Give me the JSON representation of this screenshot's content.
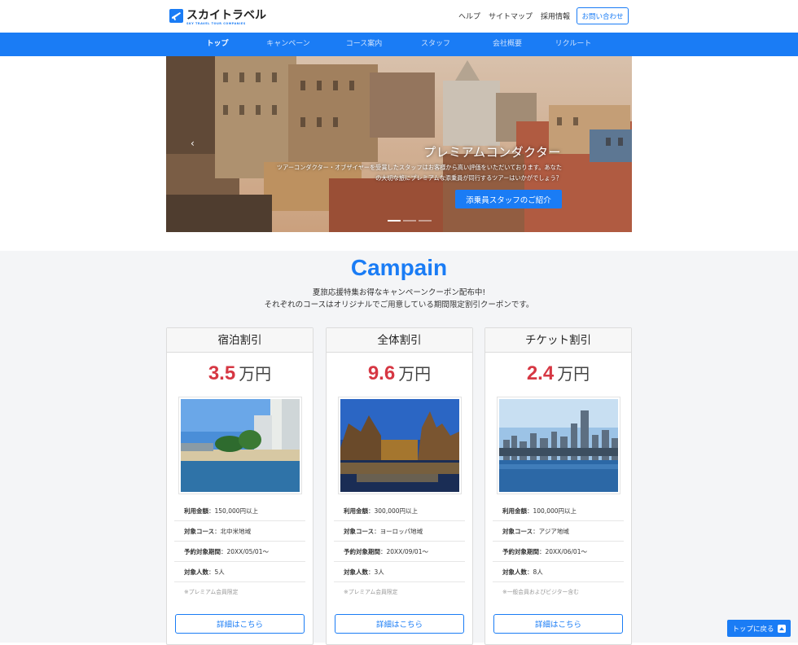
{
  "brand": {
    "name": "スカイトラベル",
    "tagline": "SKY TRAVEL TOUR COMPANIES",
    "accent": "#1a7cf5"
  },
  "util_nav": [
    "ヘルプ",
    "サイトマップ",
    "採用情報"
  ],
  "contact_label": "お問い合わせ",
  "main_nav": [
    "トップ",
    "キャンペーン",
    "コース案内",
    "スタッフ",
    "会社概要",
    "リクルート"
  ],
  "hero": {
    "title": "プレミアムコンダクター",
    "text_line1": "ツアーコンダクター・オブザイヤーを受賞したスタッフはお客様から高い評価をいただいております。あなた",
    "text_line2": "の大切な旅にプレミアムな添乗員が同行するツアーはいかがでしょう？",
    "cta": "添乗員スタッフのご紹介"
  },
  "campaign": {
    "title": "Campain",
    "desc_line1": "夏旅応援特集お得なキャンペーンクーポン配布中!",
    "desc_line2": "それぞれのコースはオリジナルでご用意している期間限定割引クーポンです。"
  },
  "cards": [
    {
      "title": "宿泊割引",
      "price": "3.5",
      "unit": "万円",
      "amount_label": "利用金額",
      "amount": "：150,000円以上",
      "course_label": "対象コース",
      "course": "：北中米地域",
      "period_label": "予約対象期間",
      "period": "：20XX/05/01〜",
      "people_label": "対象人数",
      "people": "：5人",
      "note": "※プレミアム会員限定",
      "button": "詳細はこちら"
    },
    {
      "title": "全体割引",
      "price": "9.6",
      "unit": "万円",
      "amount_label": "利用金額",
      "amount": "：300,000円以上",
      "course_label": "対象コース",
      "course": "：ヨーロッパ地域",
      "period_label": "予約対象期間",
      "period": "：20XX/09/01〜",
      "people_label": "対象人数",
      "people": "：3人",
      "note": "※プレミアム会員限定",
      "button": "詳細はこちら"
    },
    {
      "title": "チケット割引",
      "price": "2.4",
      "unit": "万円",
      "amount_label": "利用金額",
      "amount": "：100,000円以上",
      "course_label": "対象コース",
      "course": "：アジア地域",
      "period_label": "予約対象期間",
      "period": "：20XX/06/01〜",
      "people_label": "対象人数",
      "people": "：8人",
      "note": "※一般会員およびビジター含む",
      "button": "詳細はこちら"
    }
  ],
  "back_to_top": "トップに戻る",
  "colors": {
    "price": "#d63743",
    "nav_bg": "#1a7cf5",
    "section_bg": "#f4f5f7"
  }
}
